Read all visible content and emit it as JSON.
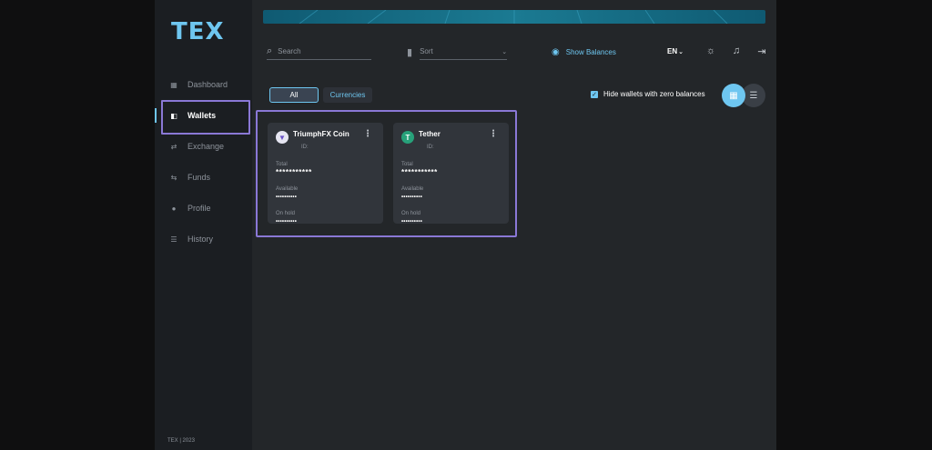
{
  "brand": {
    "logo_text": "TEX",
    "footer": "TEX | 2023"
  },
  "sidebar": {
    "items": [
      {
        "label": "Dashboard",
        "icon": "grid-icon",
        "glyph": "▦",
        "active": false
      },
      {
        "label": "Wallets",
        "icon": "wallet-icon",
        "glyph": "◧",
        "active": true
      },
      {
        "label": "Exchange",
        "icon": "exchange-icon",
        "glyph": "⇄",
        "active": false
      },
      {
        "label": "Funds",
        "icon": "funds-icon",
        "glyph": "⇆",
        "active": false
      },
      {
        "label": "Profile",
        "icon": "user-icon",
        "glyph": "●",
        "active": false
      },
      {
        "label": "History",
        "icon": "list-icon",
        "glyph": "☰",
        "active": false
      }
    ]
  },
  "toolbar": {
    "search_placeholder": "Search",
    "sort_placeholder": "Sort",
    "show_balances": "Show Balances",
    "language": "EN"
  },
  "filters": {
    "all": "All",
    "currencies": "Currencies",
    "hide_zero": "Hide wallets with zero balances",
    "hide_zero_checked": true
  },
  "wallets": [
    {
      "name": "TriumphFX Coin",
      "id_label": "ID:",
      "total_label": "Total",
      "total": "***********",
      "available_label": "Available",
      "available": "••••••••••",
      "onhold_label": "On hold",
      "onhold": "••••••••••"
    },
    {
      "name": "Tether",
      "id_label": "ID:",
      "total_label": "Total",
      "total": "***********",
      "available_label": "Available",
      "available": "••••••••••",
      "onhold_label": "On hold",
      "onhold": "••••••••••"
    }
  ],
  "colors": {
    "accent": "#6ec6f0",
    "highlight": "#8a78d6",
    "sidebar_bg": "#1b1e22",
    "main_bg": "#232629",
    "card_bg": "#31353b",
    "tether": "#27a17a"
  }
}
